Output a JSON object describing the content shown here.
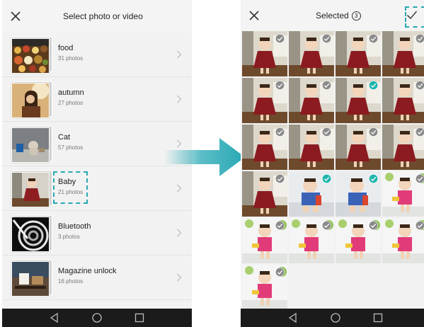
{
  "left_screen": {
    "header": {
      "title": "Select photo or video",
      "close_icon": "close-icon"
    },
    "albums": [
      {
        "name": "food",
        "count": "31 photos",
        "theme": "food"
      },
      {
        "name": "autumn",
        "count": "27 photos",
        "theme": "autumn"
      },
      {
        "name": "Cat",
        "count": "57 photos",
        "theme": "cat"
      },
      {
        "name": "Baby",
        "count": "21 photos",
        "theme": "baby"
      },
      {
        "name": "Bluetooth",
        "count": "3 photos",
        "theme": "spiral"
      },
      {
        "name": "Magazine unlock",
        "count": "16 photos",
        "theme": "magazine"
      }
    ],
    "nav": [
      "back-icon",
      "home-icon",
      "recents-icon"
    ]
  },
  "right_screen": {
    "header": {
      "title": "Selected",
      "selected_count": "3",
      "close_icon": "close-icon",
      "confirm_icon": "checkmark-icon"
    },
    "photos": [
      {
        "scene": "dress",
        "selected": false
      },
      {
        "scene": "dress",
        "selected": false
      },
      {
        "scene": "dress",
        "selected": false
      },
      {
        "scene": "dress",
        "selected": false
      },
      {
        "scene": "dress",
        "selected": false
      },
      {
        "scene": "dress",
        "selected": false
      },
      {
        "scene": "dress",
        "selected": true
      },
      {
        "scene": "dress",
        "selected": false
      },
      {
        "scene": "dress",
        "selected": false
      },
      {
        "scene": "dress",
        "selected": false
      },
      {
        "scene": "dress",
        "selected": false
      },
      {
        "scene": "dress",
        "selected": false
      },
      {
        "scene": "dress",
        "selected": false
      },
      {
        "scene": "blue",
        "selected": true
      },
      {
        "scene": "blue",
        "selected": true
      },
      {
        "scene": "pink",
        "selected": false
      },
      {
        "scene": "pink",
        "selected": false
      },
      {
        "scene": "pink",
        "selected": false
      },
      {
        "scene": "pink",
        "selected": false
      },
      {
        "scene": "pink",
        "selected": false
      },
      {
        "scene": "pink",
        "selected": false
      }
    ],
    "nav": [
      "back-icon",
      "home-icon",
      "recents-icon"
    ]
  },
  "colors": {
    "accent": "#27a8b4",
    "selected_check": "#1fb5ac",
    "unselected_check": "#8a8a8a",
    "navbar": "#1b1b1b"
  }
}
